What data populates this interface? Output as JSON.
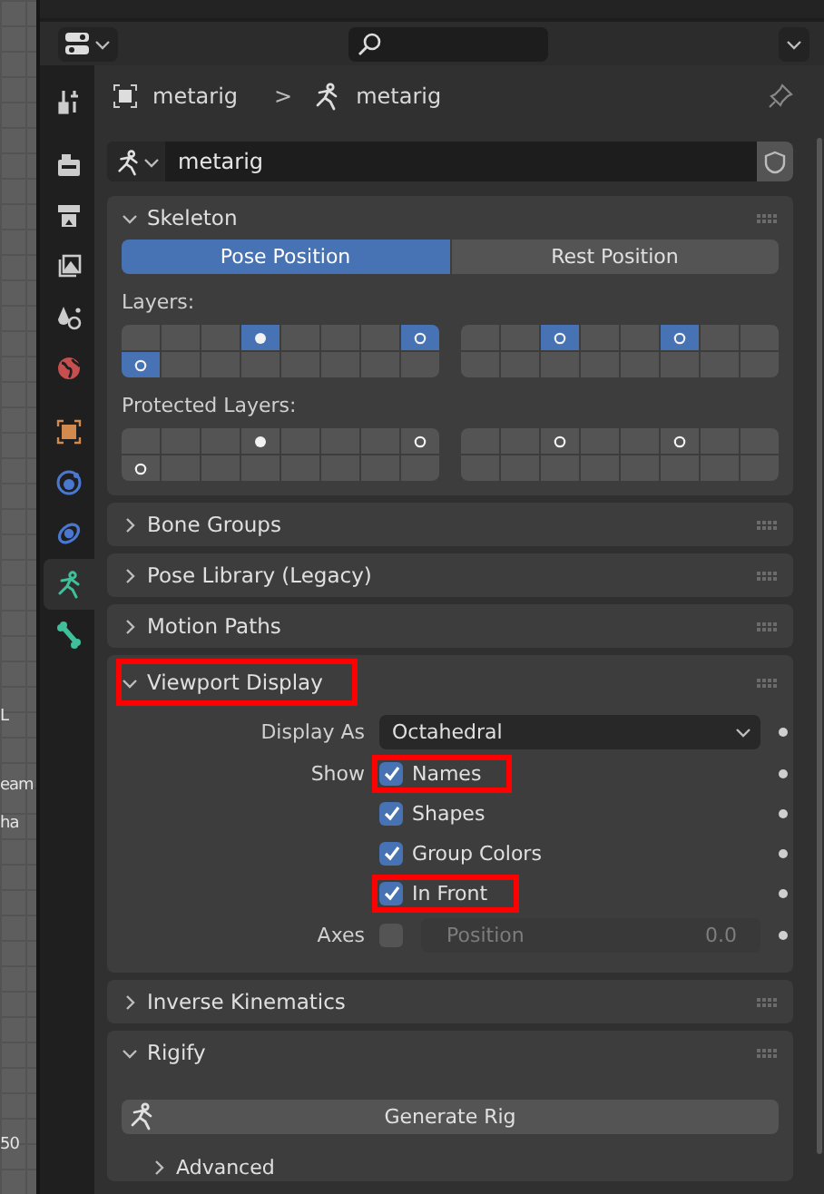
{
  "viewport_fragments": [
    {
      "text": "L"
    },
    {
      "text": "eam"
    },
    {
      "text": "ha"
    },
    {
      "text": "50"
    }
  ],
  "side_tabs": [
    {
      "kind": "tool",
      "selected": false
    },
    {
      "kind": "render",
      "selected": false
    },
    {
      "kind": "output",
      "selected": false
    },
    {
      "kind": "view-layer",
      "selected": false
    },
    {
      "kind": "scene",
      "selected": false
    },
    {
      "kind": "world",
      "selected": false
    },
    {
      "kind": "object",
      "selected": false
    },
    {
      "kind": "physics",
      "selected": false
    },
    {
      "kind": "constraint",
      "selected": false
    },
    {
      "kind": "armature",
      "selected": true
    },
    {
      "kind": "bone",
      "selected": false
    }
  ],
  "breadcrumb": {
    "object": "metarig",
    "separator": ">",
    "data": "metarig"
  },
  "datablock": {
    "name": "metarig"
  },
  "panels": [
    {
      "kind": "skeleton",
      "title": "Skeleton",
      "expanded": true,
      "highlighted": false,
      "positions": [
        {
          "label": "Pose Position",
          "selected": true
        },
        {
          "label": "Rest Position",
          "selected": false
        }
      ],
      "layers_label": "Layers:",
      "layers": [
        {
          "cells": [
            {
              "kind": "empty",
              "selected": false
            },
            {
              "kind": "empty",
              "selected": false
            },
            {
              "kind": "empty",
              "selected": false
            },
            {
              "kind": "active",
              "selected": true
            },
            {
              "kind": "empty",
              "selected": false
            },
            {
              "kind": "empty",
              "selected": false
            },
            {
              "kind": "empty",
              "selected": false
            },
            {
              "kind": "bones",
              "selected": true
            },
            {
              "kind": "bones",
              "selected": true
            },
            {
              "kind": "empty",
              "selected": false
            },
            {
              "kind": "empty",
              "selected": false
            },
            {
              "kind": "empty",
              "selected": false
            },
            {
              "kind": "empty",
              "selected": false
            },
            {
              "kind": "empty",
              "selected": false
            },
            {
              "kind": "empty",
              "selected": false
            },
            {
              "kind": "empty",
              "selected": false
            }
          ]
        },
        {
          "cells": [
            {
              "kind": "empty",
              "selected": false
            },
            {
              "kind": "empty",
              "selected": false
            },
            {
              "kind": "bones",
              "selected": true
            },
            {
              "kind": "empty",
              "selected": false
            },
            {
              "kind": "empty",
              "selected": false
            },
            {
              "kind": "bones",
              "selected": true
            },
            {
              "kind": "empty",
              "selected": false
            },
            {
              "kind": "empty",
              "selected": false
            },
            {
              "kind": "empty",
              "selected": false
            },
            {
              "kind": "empty",
              "selected": false
            },
            {
              "kind": "empty",
              "selected": false
            },
            {
              "kind": "empty",
              "selected": false
            },
            {
              "kind": "empty",
              "selected": false
            },
            {
              "kind": "empty",
              "selected": false
            },
            {
              "kind": "empty",
              "selected": false
            },
            {
              "kind": "empty",
              "selected": false
            }
          ]
        }
      ],
      "protected_label": "Protected Layers:",
      "protected_layers": [
        {
          "cells": [
            {
              "kind": "empty",
              "selected": false
            },
            {
              "kind": "empty",
              "selected": false
            },
            {
              "kind": "empty",
              "selected": false
            },
            {
              "kind": "active",
              "selected": false
            },
            {
              "kind": "empty",
              "selected": false
            },
            {
              "kind": "empty",
              "selected": false
            },
            {
              "kind": "empty",
              "selected": false
            },
            {
              "kind": "bones",
              "selected": false
            },
            {
              "kind": "bones",
              "selected": false
            },
            {
              "kind": "empty",
              "selected": false
            },
            {
              "kind": "empty",
              "selected": false
            },
            {
              "kind": "empty",
              "selected": false
            },
            {
              "kind": "empty",
              "selected": false
            },
            {
              "kind": "empty",
              "selected": false
            },
            {
              "kind": "empty",
              "selected": false
            },
            {
              "kind": "empty",
              "selected": false
            }
          ]
        },
        {
          "cells": [
            {
              "kind": "empty",
              "selected": false
            },
            {
              "kind": "empty",
              "selected": false
            },
            {
              "kind": "bones",
              "selected": false
            },
            {
              "kind": "empty",
              "selected": false
            },
            {
              "kind": "empty",
              "selected": false
            },
            {
              "kind": "bones",
              "selected": false
            },
            {
              "kind": "empty",
              "selected": false
            },
            {
              "kind": "empty",
              "selected": false
            },
            {
              "kind": "empty",
              "selected": false
            },
            {
              "kind": "empty",
              "selected": false
            },
            {
              "kind": "empty",
              "selected": false
            },
            {
              "kind": "empty",
              "selected": false
            },
            {
              "kind": "empty",
              "selected": false
            },
            {
              "kind": "empty",
              "selected": false
            },
            {
              "kind": "empty",
              "selected": false
            },
            {
              "kind": "empty",
              "selected": false
            }
          ]
        }
      ]
    },
    {
      "kind": "plain",
      "title": "Bone Groups",
      "expanded": false,
      "highlighted": false
    },
    {
      "kind": "plain",
      "title": "Pose Library (Legacy)",
      "expanded": false,
      "highlighted": false
    },
    {
      "kind": "plain",
      "title": "Motion Paths",
      "expanded": false,
      "highlighted": false
    },
    {
      "kind": "viewport",
      "title": "Viewport Display",
      "expanded": true,
      "highlighted": true,
      "display_as": {
        "label": "Display As",
        "value": "Octahedral"
      },
      "show_label": "Show",
      "show": [
        {
          "label": "Names",
          "checked": true,
          "highlighted": true
        },
        {
          "label": "Shapes",
          "checked": true,
          "highlighted": false
        },
        {
          "label": "Group Colors",
          "checked": true,
          "highlighted": false
        },
        {
          "label": "In Front",
          "checked": true,
          "highlighted": true
        }
      ],
      "axes": {
        "label": "Axes",
        "checked": false,
        "position_label": "Position",
        "position_value": "0.0"
      }
    },
    {
      "kind": "plain",
      "title": "Inverse Kinematics",
      "expanded": false,
      "highlighted": false
    },
    {
      "kind": "rigify",
      "title": "Rigify",
      "expanded": true,
      "highlighted": false,
      "button": "Generate Rig",
      "subpanel": "Advanced"
    }
  ]
}
